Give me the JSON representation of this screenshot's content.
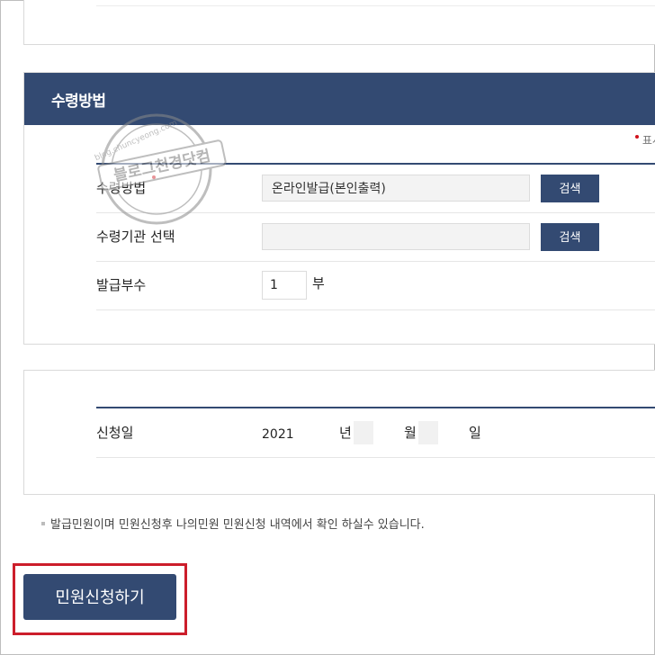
{
  "receipt": {
    "title": "수령방법",
    "required_note": "표시는",
    "rows": {
      "method_label": "수령방법",
      "method_value": "온라인발급(본인출력)",
      "agency_label": "수령기관 선택",
      "agency_value": "",
      "copies_label": "발급부수",
      "copies_value": "1",
      "copies_unit": "부"
    },
    "search_label": "검색"
  },
  "application_date": {
    "label": "신청일",
    "year": "2021",
    "year_unit": "년",
    "month_unit": "월",
    "day_unit": "일"
  },
  "notice": "발급민원이며 민원신청후 나의민원 민원신청 내역에서 확인 하실수 있습니다.",
  "submit_label": "민원신청하기",
  "watermark": {
    "line1": "블로그천경닷컴",
    "line2": "blog.chuncyeong.com"
  },
  "colors": {
    "primary": "#334a72",
    "highlight": "#cc1e2b",
    "required_dot": "#d0121b"
  }
}
